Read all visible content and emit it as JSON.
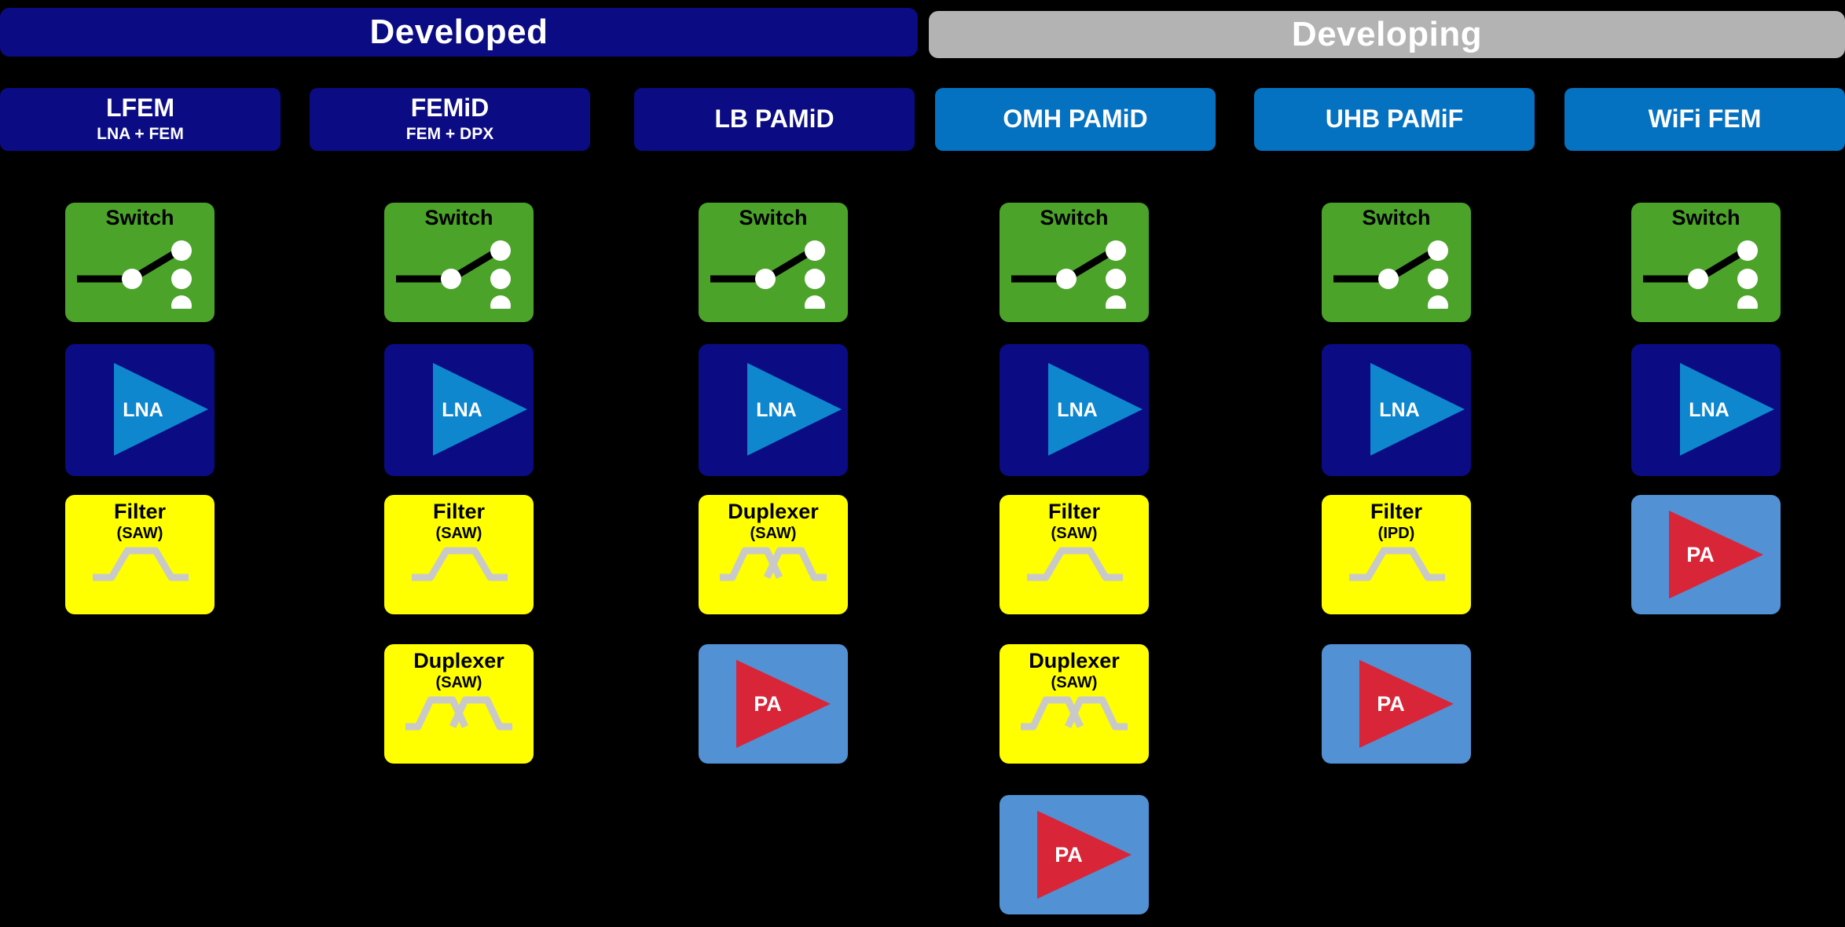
{
  "banners": [
    {
      "label": "Developed",
      "color": "#0B0B84",
      "text_color": "#FFFFFF"
    },
    {
      "label": "Developing",
      "color": "#B3B3B3",
      "text_color": "#FFFFFF"
    }
  ],
  "columns": [
    {
      "id": "lfem",
      "group": "Developed",
      "title": "LFEM",
      "subtitle": "LNA + FEM",
      "header_color": "#0B0B84",
      "blocks": [
        {
          "kind": "switch",
          "title": "Switch",
          "sub": "",
          "color": "#4CA32A",
          "row": 0
        },
        {
          "kind": "lna",
          "title": "LNA",
          "sub": "",
          "color": "#0B0B84",
          "row": 1
        },
        {
          "kind": "filter",
          "title": "Filter",
          "sub": "(SAW)",
          "color": "#FFFF00",
          "row": 2,
          "curve": "bandpass"
        }
      ]
    },
    {
      "id": "femid",
      "group": "Developed",
      "title": "FEMiD",
      "subtitle": "FEM + DPX",
      "header_color": "#0B0B84",
      "blocks": [
        {
          "kind": "switch",
          "title": "Switch",
          "sub": "",
          "color": "#4CA32A",
          "row": 0
        },
        {
          "kind": "lna",
          "title": "LNA",
          "sub": "",
          "color": "#0B0B84",
          "row": 1
        },
        {
          "kind": "filter",
          "title": "Filter",
          "sub": "(SAW)",
          "color": "#FFFF00",
          "row": 2,
          "curve": "bandpass"
        },
        {
          "kind": "filter",
          "title": "Duplexer",
          "sub": "(SAW)",
          "color": "#FFFF00",
          "row": 3,
          "curve": "duplex"
        }
      ]
    },
    {
      "id": "lb-pamid",
      "group": "Developed",
      "title": "LB PAMiD",
      "subtitle": "",
      "header_color": "#0B0B84",
      "blocks": [
        {
          "kind": "switch",
          "title": "Switch",
          "sub": "",
          "color": "#4CA32A",
          "row": 0
        },
        {
          "kind": "lna",
          "title": "LNA",
          "sub": "",
          "color": "#0B0B84",
          "row": 1
        },
        {
          "kind": "filter",
          "title": "Duplexer",
          "sub": "(SAW)",
          "color": "#FFFF00",
          "row": 2,
          "curve": "duplex"
        },
        {
          "kind": "pa",
          "title": "PA",
          "sub": "",
          "color": "#5191D4",
          "row": 3
        }
      ]
    },
    {
      "id": "omh-pamid",
      "group": "Developing",
      "title": "OMH PAMiD",
      "subtitle": "",
      "header_color": "#0571C1",
      "blocks": [
        {
          "kind": "switch",
          "title": "Switch",
          "sub": "",
          "color": "#4CA32A",
          "row": 0
        },
        {
          "kind": "lna",
          "title": "LNA",
          "sub": "",
          "color": "#0B0B84",
          "row": 1
        },
        {
          "kind": "filter",
          "title": "Filter",
          "sub": "(SAW)",
          "color": "#FFFF00",
          "row": 2,
          "curve": "bandpass"
        },
        {
          "kind": "filter",
          "title": "Duplexer",
          "sub": "(SAW)",
          "color": "#FFFF00",
          "row": 3,
          "curve": "duplex"
        },
        {
          "kind": "pa",
          "title": "PA",
          "sub": "",
          "color": "#5191D4",
          "row": 4
        }
      ]
    },
    {
      "id": "uhb-pamif",
      "group": "Developing",
      "title": "UHB PAMiF",
      "subtitle": "",
      "header_color": "#0571C1",
      "blocks": [
        {
          "kind": "switch",
          "title": "Switch",
          "sub": "",
          "color": "#4CA32A",
          "row": 0
        },
        {
          "kind": "lna",
          "title": "LNA",
          "sub": "",
          "color": "#0B0B84",
          "row": 1
        },
        {
          "kind": "filter",
          "title": "Filter",
          "sub": "(IPD)",
          "color": "#FFFF00",
          "row": 2,
          "curve": "bandpass"
        },
        {
          "kind": "pa",
          "title": "PA",
          "sub": "",
          "color": "#5191D4",
          "row": 3
        }
      ]
    },
    {
      "id": "wifi-fem",
      "group": "Developing",
      "title": "WiFi FEM",
      "subtitle": "",
      "header_color": "#0571C1",
      "blocks": [
        {
          "kind": "switch",
          "title": "Switch",
          "sub": "",
          "color": "#4CA32A",
          "row": 0
        },
        {
          "kind": "lna",
          "title": "LNA",
          "sub": "",
          "color": "#0B0B84",
          "row": 1
        },
        {
          "kind": "pa",
          "title": "PA",
          "sub": "",
          "color": "#5191D4",
          "row": 2
        }
      ]
    }
  ],
  "palette": {
    "background": "#000000",
    "navy": "#0B0B84",
    "blue": "#0571C1",
    "grey": "#B3B3B3",
    "green": "#4CA32A",
    "yellow": "#FFFF00",
    "light_blue": "#5191D4",
    "red": "#D92538",
    "lna_triangle": "#0E87CE",
    "curve_grey": "#C9C9C9",
    "white": "#FFFFFF",
    "black": "#000000"
  },
  "icons": {
    "switch": "rf-switch-icon",
    "lna": "amplifier-triangle-icon",
    "pa": "power-amplifier-triangle-icon",
    "bandpass": "bandpass-response-icon",
    "duplex": "duplex-response-icon"
  }
}
